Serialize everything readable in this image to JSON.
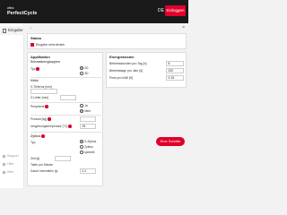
{
  "header": {
    "logo_small": "wiha",
    "logo_main": "PerfectCycle",
    "lang": "DE",
    "login_label": "Einloggen"
  },
  "sidebar": {
    "items": [
      {
        "label": "Eingabe"
      }
    ],
    "footer": [
      {
        "label": "Support"
      },
      {
        "label": "Hilfe"
      },
      {
        "label": "Web"
      }
    ]
  },
  "status": {
    "title": "Status",
    "row_label": "Eingabe erforderlich"
  },
  "application": {
    "title": "Applikation",
    "screw_section": "Schraubengruppen",
    "type_label": "Typ",
    "type_options": [
      {
        "label": "2D",
        "selected": true
      },
      {
        "label": "3D",
        "selected": false
      }
    ],
    "hole_section": "Höhe",
    "x_depth_label": "X-Tiefe/us [mm]",
    "z_depth_label": "Z-Liefer [mm]",
    "periphery_label": "Peripherie",
    "periphery_options": [
      {
        "label": "Ja",
        "selected": false
      },
      {
        "label": "Nein",
        "selected": true
      }
    ],
    "product_label": "Produkt [kg]",
    "ambient_label": "Umgebungstemperatur [°C]",
    "ambient_value": "25",
    "cycle_section": "Zyklus",
    "cycle_type_label": "Typ",
    "cycle_options": [
      {
        "label": "S-Zyklus",
        "selected": true
      },
      {
        "label": "Zyklus",
        "selected": false
      },
      {
        "label": "speziell",
        "selected": false
      }
    ],
    "time_label": "Zeit [s]",
    "cycles_label": "Takte pro Minute",
    "duration_label": "Dauer Intervallen [s]",
    "duration_value": "0.1"
  },
  "energy": {
    "title": "Energiekosten",
    "rows": [
      {
        "label": "Betriebsstunden pro Tag [h]",
        "value": "8"
      },
      {
        "label": "Betriebstage pro Jahr [d]",
        "value": "220"
      },
      {
        "label": "Preis pro kWh [€]",
        "value": "0.15"
      }
    ]
  },
  "fab_label": "Eine Schritte",
  "colors": {
    "accent": "#e0002b",
    "topbar": "#1a1a1a"
  }
}
